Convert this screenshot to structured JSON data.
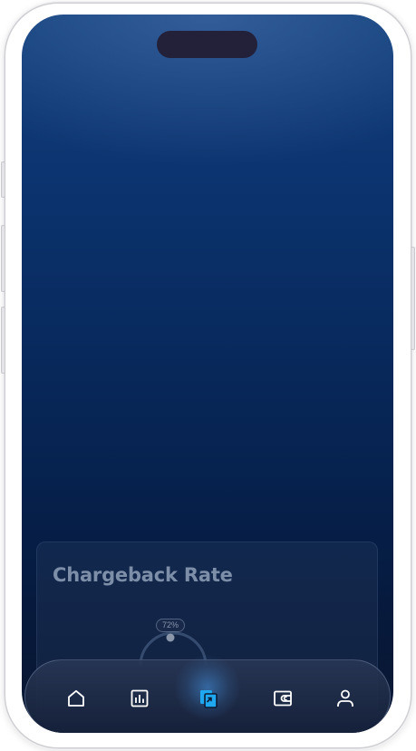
{
  "card": {
    "title": "Chargeback Rate",
    "gauge_badge": "72%",
    "gauge_value_percent": 72
  },
  "tabbar": {
    "items": [
      {
        "icon": "home-icon",
        "active": false
      },
      {
        "icon": "bar-chart-icon",
        "active": false
      },
      {
        "icon": "cards-icon",
        "active": true
      },
      {
        "icon": "wallet-icon",
        "active": false
      },
      {
        "icon": "user-icon",
        "active": false
      }
    ],
    "active_color": "#1fa8f0",
    "inactive_color": "#ffffff"
  },
  "colors": {
    "screen_top": "#123f7a",
    "screen_bottom": "#0b1830",
    "dynamic_island": "#23213a"
  }
}
